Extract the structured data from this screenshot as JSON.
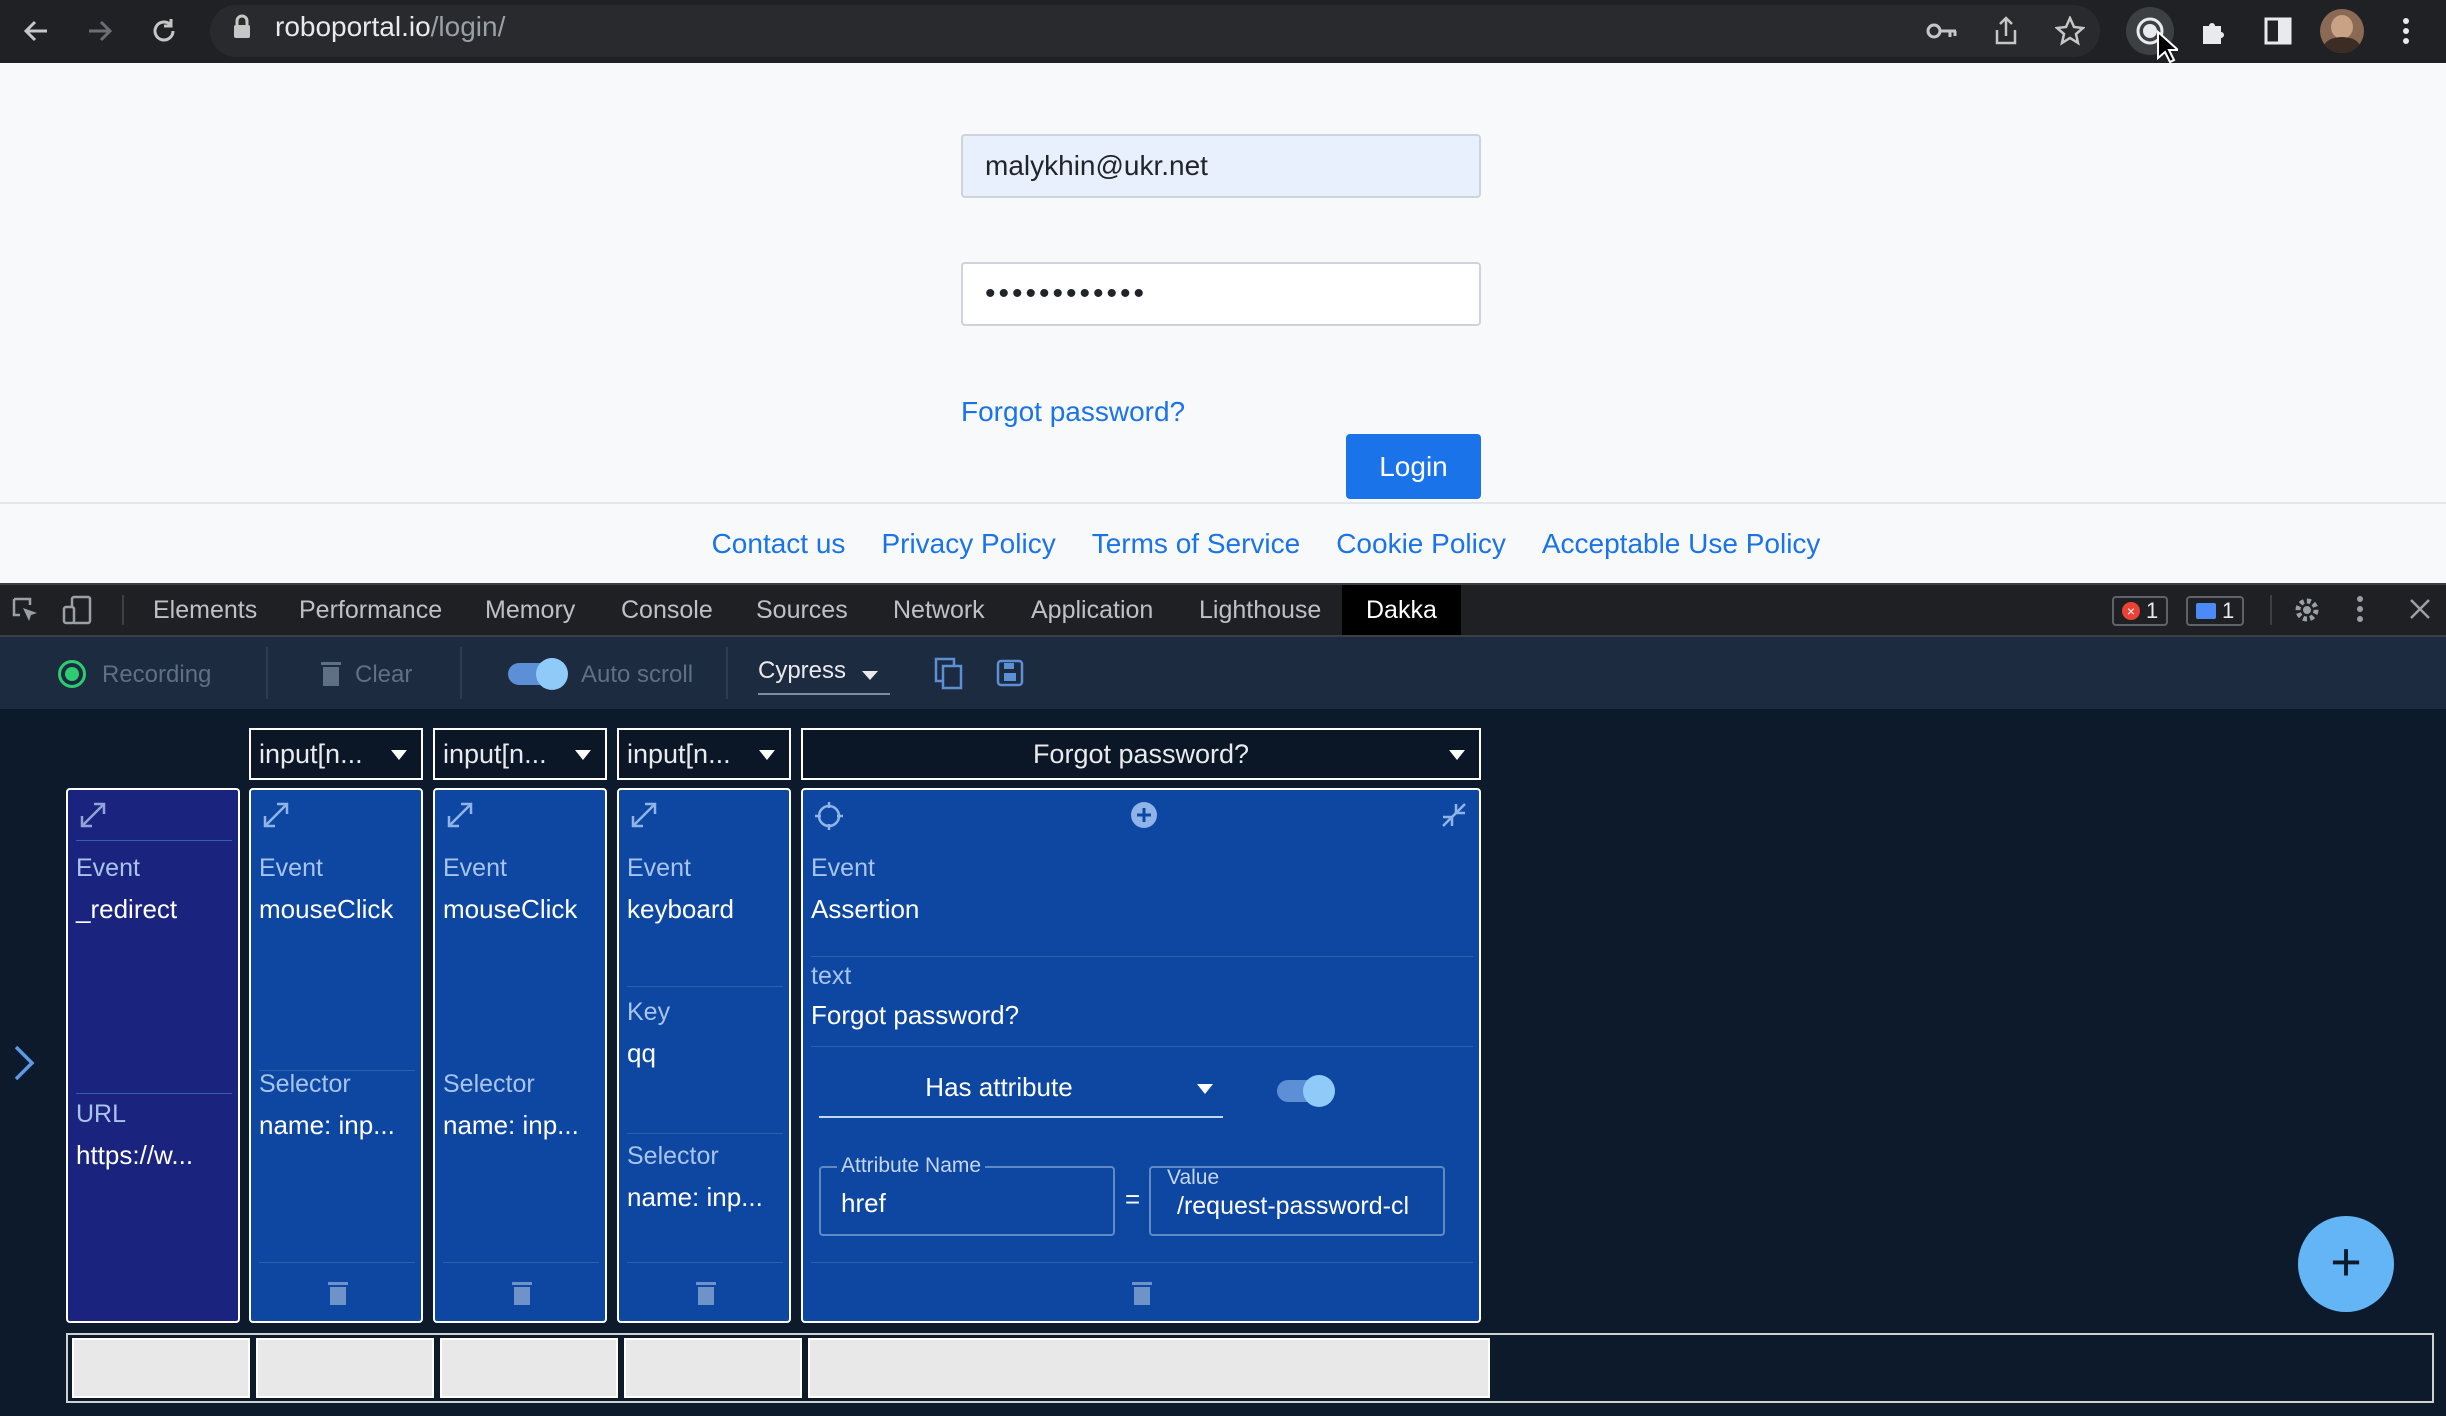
{
  "browser": {
    "url_host": "roboportal.io",
    "url_path": "/login/"
  },
  "page": {
    "email_value": "malykhin@ukr.net",
    "password_mask": "••••••••••••",
    "forgot_link": "Forgot password?",
    "login_button": "Login",
    "footer_links": [
      "Contact us",
      "Privacy Policy",
      "Terms of Service",
      "Cookie Policy",
      "Acceptable Use Policy"
    ]
  },
  "devtools": {
    "tabs": [
      "Elements",
      "Performance",
      "Memory",
      "Console",
      "Sources",
      "Network",
      "Application",
      "Lighthouse",
      "Dakka"
    ],
    "error_count": "1",
    "message_count": "1"
  },
  "dakka": {
    "toolbar": {
      "recording": "Recording",
      "clear": "Clear",
      "auto_scroll": "Auto scroll",
      "framework": "Cypress"
    },
    "selectors": [
      "input[n...",
      "input[n...",
      "input[n...",
      "Forgot password?"
    ],
    "cards": {
      "redirect": {
        "event_label": "Event",
        "event": "_redirect",
        "url_label": "URL",
        "url": "https://w..."
      },
      "click1": {
        "event_label": "Event",
        "event": "mouseClick",
        "selector_label": "Selector",
        "selector": "name: inp..."
      },
      "click2": {
        "event_label": "Event",
        "event": "mouseClick",
        "selector_label": "Selector",
        "selector": "name: inp..."
      },
      "keyboard": {
        "event_label": "Event",
        "event": "keyboard",
        "key_label": "Key",
        "key": "qq",
        "selector_label": "Selector",
        "selector": "name: inp..."
      },
      "assertion": {
        "event_label": "Event",
        "event": "Assertion",
        "text_label": "text",
        "text": "Forgot password?",
        "assertion_type": "Has attribute",
        "attr_name_label": "Attribute Name",
        "attr_name": "href",
        "equals": "=",
        "value_label": "Value",
        "value": "/request-password-cl"
      }
    },
    "fab_label": "+"
  },
  "colors": {
    "card_blue": "#0d47a1",
    "accent": "#1a73e8",
    "toggle": "#64b5f6"
  }
}
